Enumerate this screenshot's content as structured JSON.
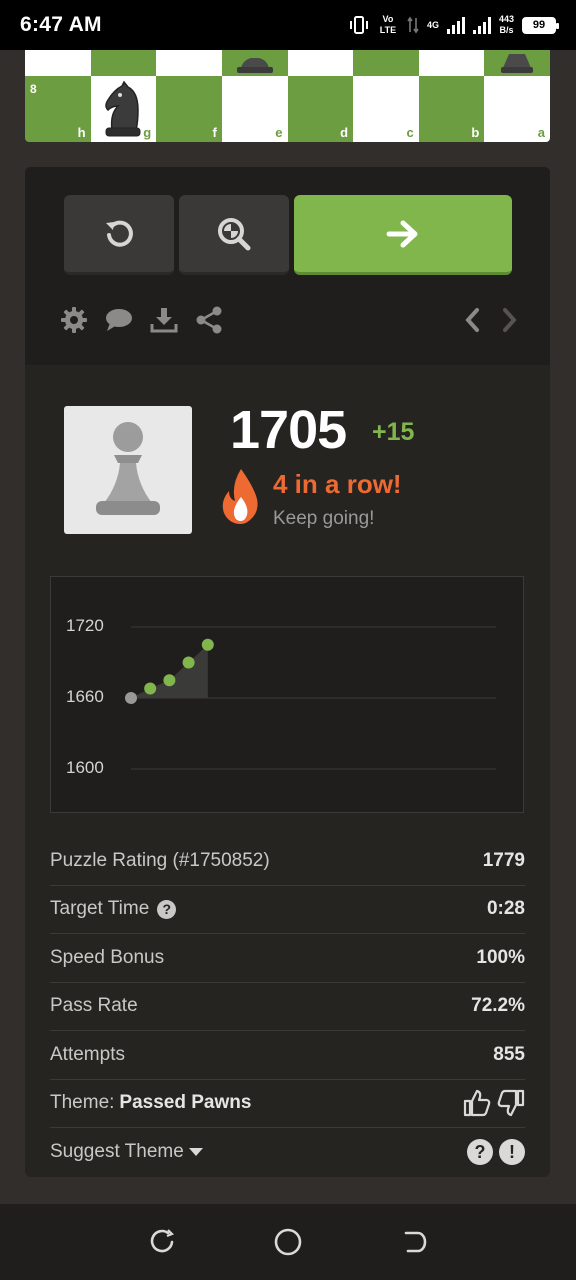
{
  "status_bar": {
    "time": "6:47 AM",
    "volte": "Vo LTE",
    "network": "4G",
    "net_speed_value": "443",
    "net_speed_unit": "B/s",
    "battery": "99"
  },
  "board": {
    "rank": "8",
    "files": [
      "h",
      "g",
      "f",
      "e",
      "d",
      "c",
      "b",
      "a"
    ]
  },
  "icons": {
    "retry": "retry-icon",
    "analyze": "analysis-icon",
    "next": "arrow-right-icon",
    "settings": "gear-icon",
    "comments": "chat-bubble-icon",
    "download": "download-icon",
    "share": "share-icon",
    "prev": "chevron-left-icon",
    "forward": "chevron-right-icon"
  },
  "result": {
    "rating": "1705",
    "delta": "+15",
    "streak": "4 in a row!",
    "message": "Keep going!"
  },
  "chart_data": {
    "type": "line",
    "x": [
      1,
      2,
      3,
      4,
      5
    ],
    "values": [
      1660,
      1668,
      1675,
      1690,
      1705
    ],
    "yticks": [
      "1720",
      "1660",
      "1600"
    ],
    "ylim": [
      1600,
      1720
    ],
    "grid": true,
    "colors": {
      "up": "#81b64c",
      "start": "#999999",
      "area": "#3a3a38"
    }
  },
  "stats": {
    "puzzle_rating_label": "Puzzle Rating (#1750852)",
    "puzzle_rating": "1779",
    "target_time_label": "Target Time",
    "target_time": "0:28",
    "speed_bonus_label": "Speed Bonus",
    "speed_bonus": "100%",
    "pass_rate_label": "Pass Rate",
    "pass_rate": "72.2%",
    "attempts_label": "Attempts",
    "attempts": "855",
    "theme_label": "Theme:",
    "theme_value": "Passed Pawns",
    "suggest_label": "Suggest Theme",
    "help_glyph": "?",
    "report_glyph": "!"
  },
  "colors": {
    "background": "#312e2b",
    "card": "#262421",
    "accent_green": "#81b64c",
    "streak_orange": "#ee6a33"
  }
}
